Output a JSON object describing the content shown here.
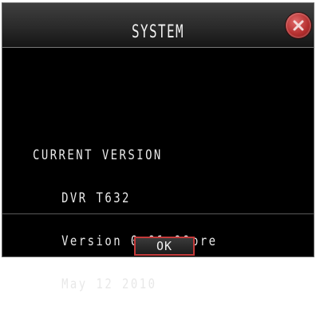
{
  "dialog": {
    "title": "SYSTEM",
    "close_icon": "close-x-icon",
    "accent_color": "#c43a3a"
  },
  "info": {
    "heading": "CURRENT VERSION",
    "model": "DVR T632",
    "version": "Version 0.01.00pre",
    "date": "May 12 2010"
  },
  "buttons": {
    "ok_label": "OK"
  }
}
